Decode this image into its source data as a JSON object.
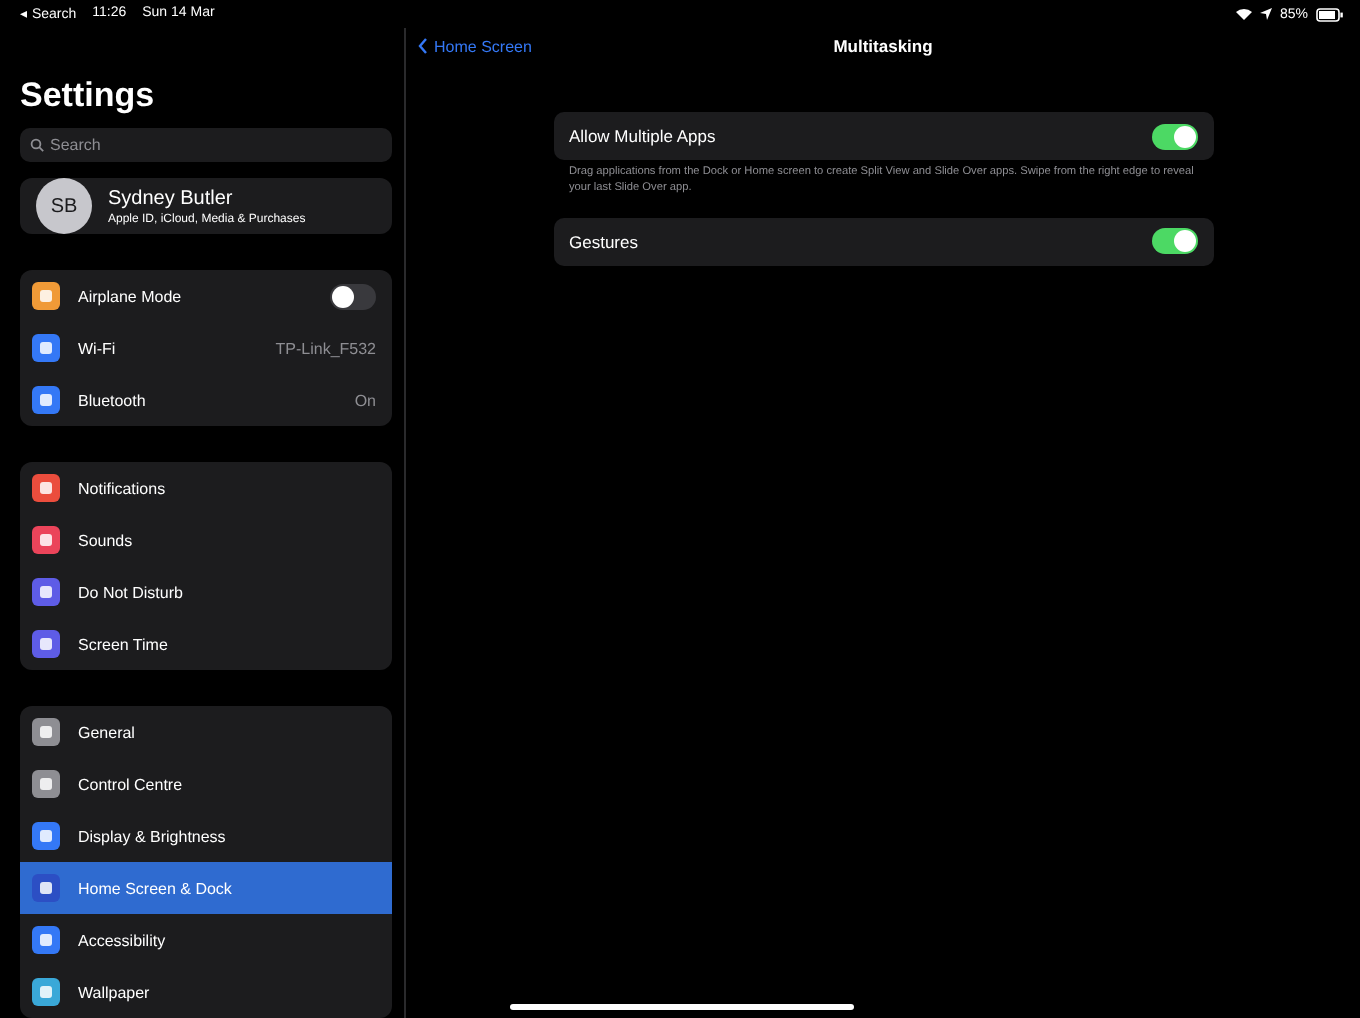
{
  "status_bar": {
    "back_app": "◂ Search",
    "time": "11:26",
    "date": "Sun 14 Mar",
    "battery": "85%"
  },
  "sidebar": {
    "title": "Settings",
    "search": {
      "placeholder": "Search"
    },
    "profile": {
      "initials": "SB",
      "name": "Sydney Butler",
      "subtitle": "Apple ID, iCloud, Media & Purchases"
    },
    "groups": [
      {
        "items": [
          {
            "label": "Airplane Mode",
            "kind": "toggle",
            "on": false,
            "color": "#f09a37",
            "selected": false
          },
          {
            "label": "Wi-Fi",
            "kind": "value",
            "value": "TP-Link_F532",
            "color": "#3478f6",
            "selected": false
          },
          {
            "label": "Bluetooth",
            "kind": "value",
            "value": "On",
            "color": "#3478f6",
            "selected": false
          }
        ]
      },
      {
        "items": [
          {
            "label": "Notifications",
            "kind": "plain",
            "color": "#eb4d3d",
            "selected": false
          },
          {
            "label": "Sounds",
            "kind": "plain",
            "color": "#eb445a",
            "selected": false
          },
          {
            "label": "Do Not Disturb",
            "kind": "plain",
            "color": "#5e5ce6",
            "selected": false
          },
          {
            "label": "Screen Time",
            "kind": "plain",
            "color": "#5e5ce6",
            "selected": false
          }
        ]
      },
      {
        "items": [
          {
            "label": "General",
            "kind": "plain",
            "color": "#8e8e93",
            "selected": false
          },
          {
            "label": "Control Centre",
            "kind": "plain",
            "color": "#8e8e93",
            "selected": false
          },
          {
            "label": "Display & Brightness",
            "kind": "plain",
            "color": "#3478f6",
            "selected": false
          },
          {
            "label": "Home Screen & Dock",
            "kind": "plain",
            "color": "#2c4fc4",
            "selected": true
          },
          {
            "label": "Accessibility",
            "kind": "plain",
            "color": "#3478f6",
            "selected": false
          },
          {
            "label": "Wallpaper",
            "kind": "plain",
            "color": "#3aa8d8",
            "selected": false
          }
        ]
      }
    ]
  },
  "detail": {
    "back": "Home Screen",
    "title": "Multitasking",
    "settings": [
      {
        "label": "Allow Multiple Apps",
        "on": true,
        "footnote": "Drag applications from the Dock or Home screen to create Split View and Slide Over apps. Swipe from the right edge to reveal your last Slide Over app."
      },
      {
        "label": "Gestures",
        "on": true
      }
    ]
  }
}
